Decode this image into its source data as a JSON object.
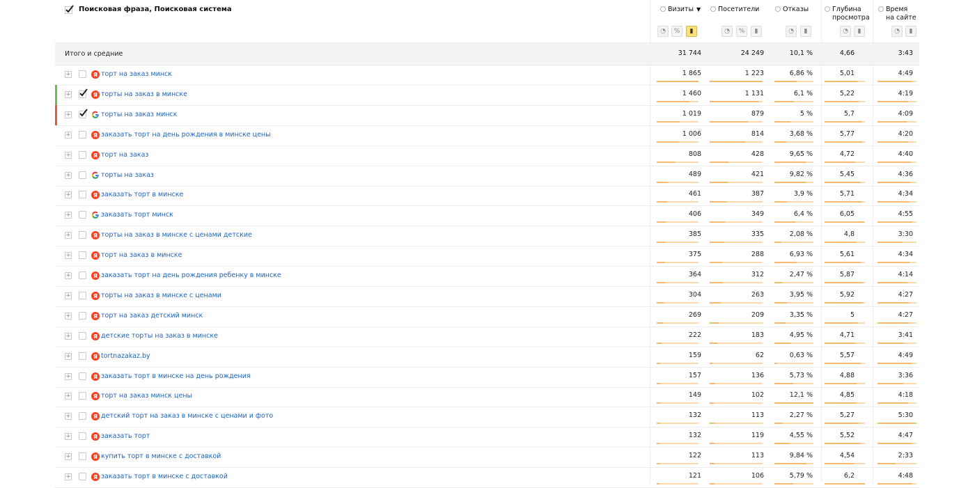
{
  "header": {
    "title": "Поисковая фраза, Поисковая система",
    "metrics": [
      "Визиты",
      "Посетители",
      "Отказы",
      "Глубина\nпросмотра",
      "Время\nна сайте"
    ],
    "sort_indicator": "▼"
  },
  "totals": {
    "label": "Итого и средние",
    "values": [
      "31 744",
      "24 249",
      "10,1 %",
      "4,66",
      "3:43"
    ]
  },
  "rows": [
    {
      "phrase": "торт на заказ минск",
      "engine": "yandex-icon",
      "checked": false,
      "marker": "",
      "values": [
        "1 865",
        "1 223",
        "6,86 %",
        "5,01",
        "4:49"
      ]
    },
    {
      "phrase": "торты на заказ в минске",
      "engine": "yandex-icon",
      "checked": true,
      "marker": "#6cc04a",
      "values": [
        "1 460",
        "1 131",
        "6,1 %",
        "5,22",
        "4:19"
      ]
    },
    {
      "phrase": "торты на заказ минск",
      "engine": "google-icon",
      "checked": true,
      "marker": "#e8573e",
      "values": [
        "1 019",
        "879",
        "5 %",
        "5,7",
        "4:09"
      ]
    },
    {
      "phrase": "заказать торт на день рождения в минске цены",
      "engine": "yandex-icon",
      "checked": false,
      "marker": "",
      "values": [
        "1 006",
        "814",
        "3,68 %",
        "5,77",
        "4:20"
      ]
    },
    {
      "phrase": "торт на заказ",
      "engine": "yandex-icon",
      "checked": false,
      "marker": "",
      "values": [
        "808",
        "428",
        "9,65 %",
        "4,72",
        "4:40"
      ]
    },
    {
      "phrase": "торты на заказ",
      "engine": "google-icon",
      "checked": false,
      "marker": "",
      "values": [
        "489",
        "421",
        "9,82 %",
        "5,45",
        "4:36"
      ]
    },
    {
      "phrase": "заказать торт в минске",
      "engine": "yandex-icon",
      "checked": false,
      "marker": "",
      "values": [
        "461",
        "387",
        "3,9 %",
        "5,71",
        "4:34"
      ]
    },
    {
      "phrase": "заказать торт минск",
      "engine": "google-icon",
      "checked": false,
      "marker": "",
      "values": [
        "406",
        "349",
        "6,4 %",
        "6,05",
        "4:55"
      ]
    },
    {
      "phrase": "торты на заказ в минске с ценами детские",
      "engine": "yandex-icon",
      "checked": false,
      "marker": "",
      "values": [
        "385",
        "335",
        "2,08 %",
        "4,8",
        "3:30"
      ]
    },
    {
      "phrase": "торт на заказ в минске",
      "engine": "yandex-icon",
      "checked": false,
      "marker": "",
      "values": [
        "375",
        "288",
        "6,93 %",
        "5,61",
        "4:34"
      ]
    },
    {
      "phrase": "заказать торт на день рождения ребенку в минске",
      "engine": "yandex-icon",
      "checked": false,
      "marker": "",
      "values": [
        "364",
        "312",
        "2,47 %",
        "5,87",
        "4:14"
      ]
    },
    {
      "phrase": "торты на заказ в минске с ценами",
      "engine": "yandex-icon",
      "checked": false,
      "marker": "",
      "values": [
        "304",
        "263",
        "3,95 %",
        "5,92",
        "4:27"
      ]
    },
    {
      "phrase": "торт на заказ детский минск",
      "engine": "yandex-icon",
      "checked": false,
      "marker": "",
      "values": [
        "269",
        "209",
        "3,35 %",
        "5",
        "4:27"
      ]
    },
    {
      "phrase": "детские торты на заказ в минске",
      "engine": "yandex-icon",
      "checked": false,
      "marker": "",
      "values": [
        "222",
        "183",
        "4,95 %",
        "4,71",
        "3:41"
      ]
    },
    {
      "phrase": "tortnazakaz.by",
      "engine": "yandex-icon",
      "checked": false,
      "marker": "",
      "values": [
        "159",
        "62",
        "0,63 %",
        "5,57",
        "4:49"
      ]
    },
    {
      "phrase": "заказать торт в минске на день рождения",
      "engine": "yandex-icon",
      "checked": false,
      "marker": "",
      "values": [
        "157",
        "136",
        "5,73 %",
        "4,88",
        "3:36"
      ]
    },
    {
      "phrase": "торт на заказ минск цены",
      "engine": "yandex-icon",
      "checked": false,
      "marker": "",
      "values": [
        "149",
        "102",
        "12,1 %",
        "4,85",
        "4:18"
      ]
    },
    {
      "phrase": "детский торт на заказ в минске с ценами и фото",
      "engine": "yandex-icon",
      "checked": false,
      "marker": "",
      "values": [
        "132",
        "113",
        "2,27 %",
        "5,27",
        "5:30"
      ]
    },
    {
      "phrase": "заказать торт",
      "engine": "yandex-icon",
      "checked": false,
      "marker": "",
      "values": [
        "132",
        "119",
        "4,55 %",
        "5,52",
        "4:47"
      ]
    },
    {
      "phrase": "купить торт в минске с доставкой",
      "engine": "yandex-icon",
      "checked": false,
      "marker": "",
      "values": [
        "122",
        "113",
        "9,84 %",
        "4,54",
        "2:33"
      ]
    },
    {
      "phrase": "заказать торт в минске с доставкой",
      "engine": "yandex-icon",
      "checked": false,
      "marker": "",
      "values": [
        "121",
        "106",
        "5,79 %",
        "6,2",
        "4:48"
      ]
    }
  ],
  "colors": {
    "link": "#1a64c8",
    "bar": "#f7b96c",
    "yandex": "#fc3f1d",
    "active_view": "#ffe07a"
  }
}
